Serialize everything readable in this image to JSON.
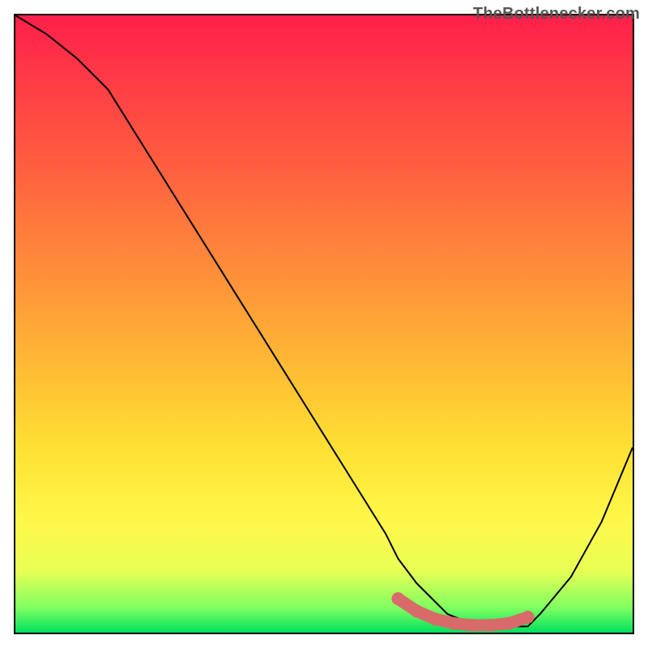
{
  "watermark": {
    "text": "TheBottlenecker.com"
  },
  "chart_data": {
    "type": "line",
    "title": "",
    "xlabel": "",
    "ylabel": "",
    "xlim": [
      0,
      100
    ],
    "ylim": [
      0,
      100
    ],
    "series": [
      {
        "name": "bottleneck-curve",
        "x": [
          0,
          5,
          10,
          15,
          20,
          25,
          30,
          35,
          40,
          45,
          50,
          55,
          60,
          62,
          65,
          70,
          75,
          80,
          83,
          85,
          90,
          95,
          100
        ],
        "y": [
          100,
          97,
          93,
          88,
          80,
          72,
          64,
          56,
          48,
          40,
          32,
          24,
          16,
          12,
          8,
          3,
          1,
          1,
          1,
          3,
          9,
          18,
          30
        ]
      }
    ],
    "highlight": {
      "name": "optimal-range",
      "x": [
        62,
        65,
        68,
        71,
        74,
        77,
        80,
        83
      ],
      "y": [
        5.5,
        3.5,
        2.2,
        1.5,
        1.2,
        1.2,
        1.5,
        2.5
      ],
      "color": "#d86a6a"
    },
    "gradient_colors": {
      "top": "#ff1f4b",
      "mid_upper": "#ff8a3a",
      "mid": "#ffe033",
      "mid_lower": "#e8ff55",
      "bottom": "#00e060"
    }
  }
}
